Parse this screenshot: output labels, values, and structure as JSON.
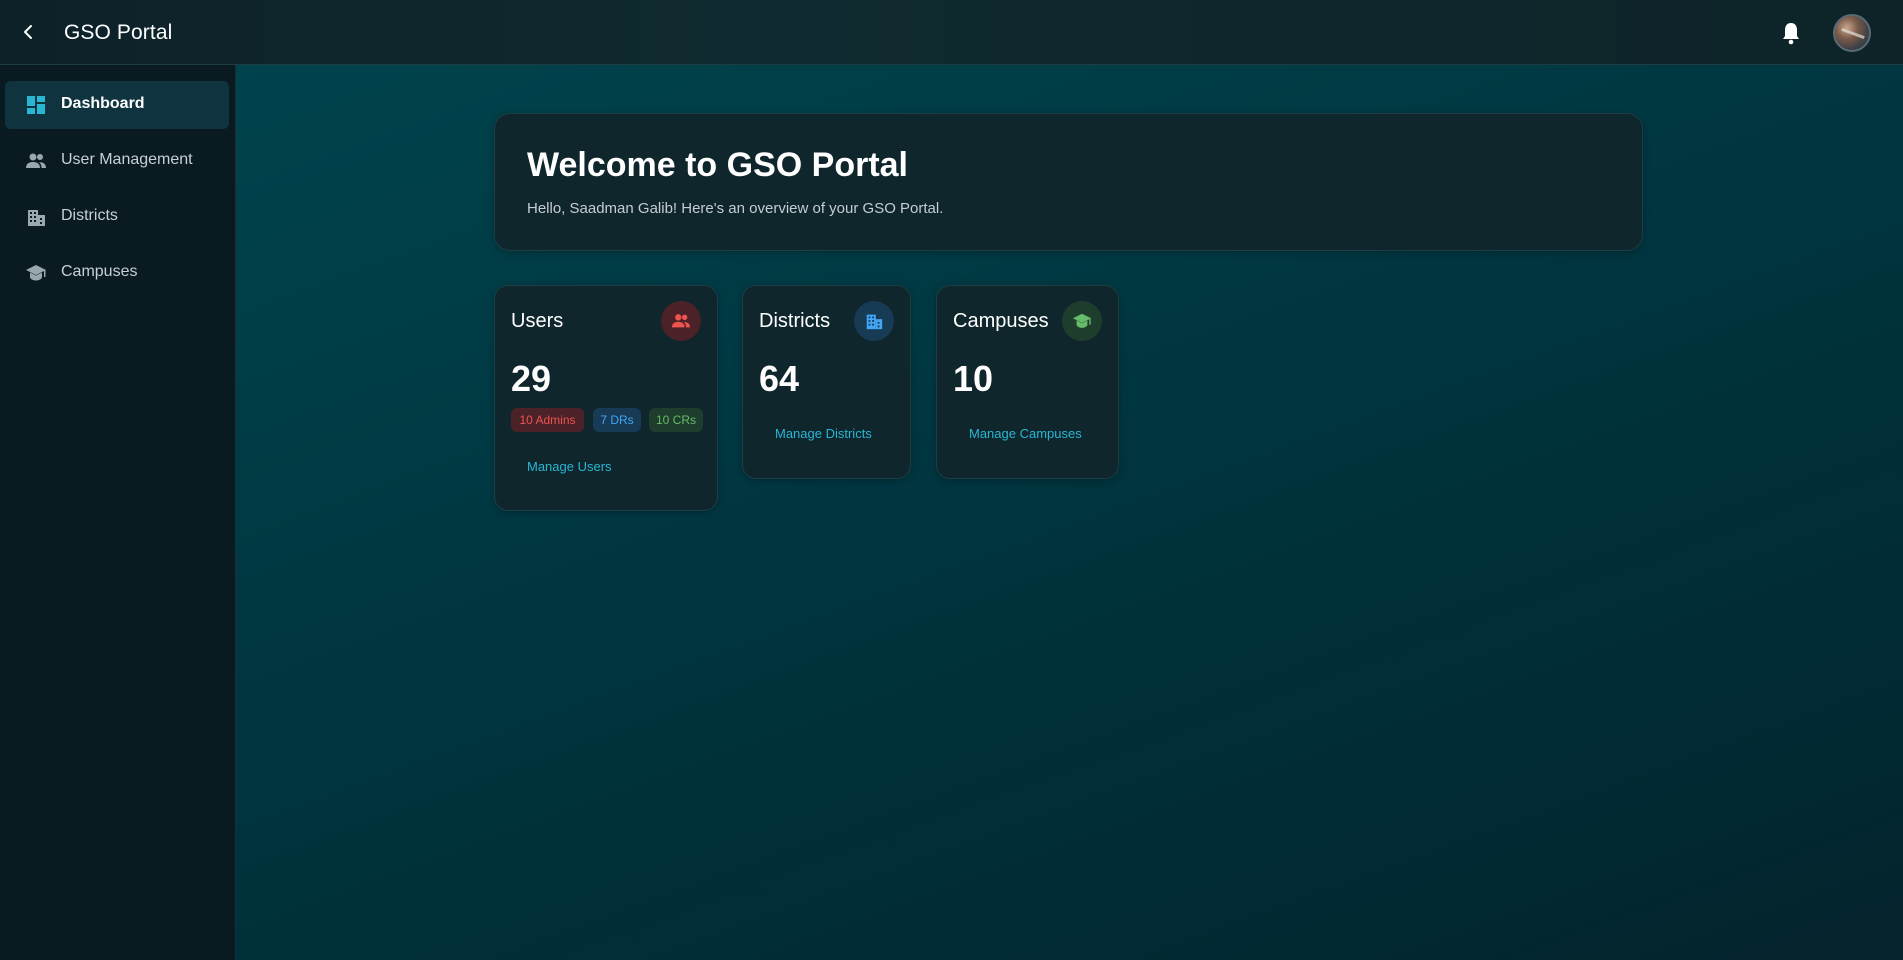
{
  "header": {
    "title": "GSO Portal",
    "back_icon": "chevron-left-icon",
    "notification_icon": "bell-icon"
  },
  "sidebar": {
    "items": [
      {
        "label": "Dashboard",
        "icon": "dashboard-icon",
        "active": true
      },
      {
        "label": "User Management",
        "icon": "people-icon",
        "active": false
      },
      {
        "label": "Districts",
        "icon": "buildings-icon",
        "active": false
      },
      {
        "label": "Campuses",
        "icon": "graduation-cap-icon",
        "active": false
      }
    ]
  },
  "welcome": {
    "title": "Welcome to GSO Portal",
    "subtitle": "Hello, Saadman Galib! Here's an overview of your GSO Portal."
  },
  "stats": {
    "users": {
      "title": "Users",
      "value": "29",
      "icon": "people-icon",
      "chips": [
        {
          "label": "10 Admins",
          "color": "#ef5350"
        },
        {
          "label": "7 DRs",
          "color": "#42a5f5"
        },
        {
          "label": "10 CRs",
          "color": "#66bb6a"
        }
      ],
      "link": "Manage Users"
    },
    "districts": {
      "title": "Districts",
      "value": "64",
      "icon": "buildings-icon",
      "link": "Manage Districts"
    },
    "campuses": {
      "title": "Campuses",
      "value": "10",
      "icon": "graduation-cap-icon",
      "link": "Manage Campuses"
    }
  },
  "colors": {
    "accent": "#29b6d2",
    "users_accent": "#ef5350",
    "districts_accent": "#42a5f5",
    "campuses_accent": "#66bb6a"
  }
}
